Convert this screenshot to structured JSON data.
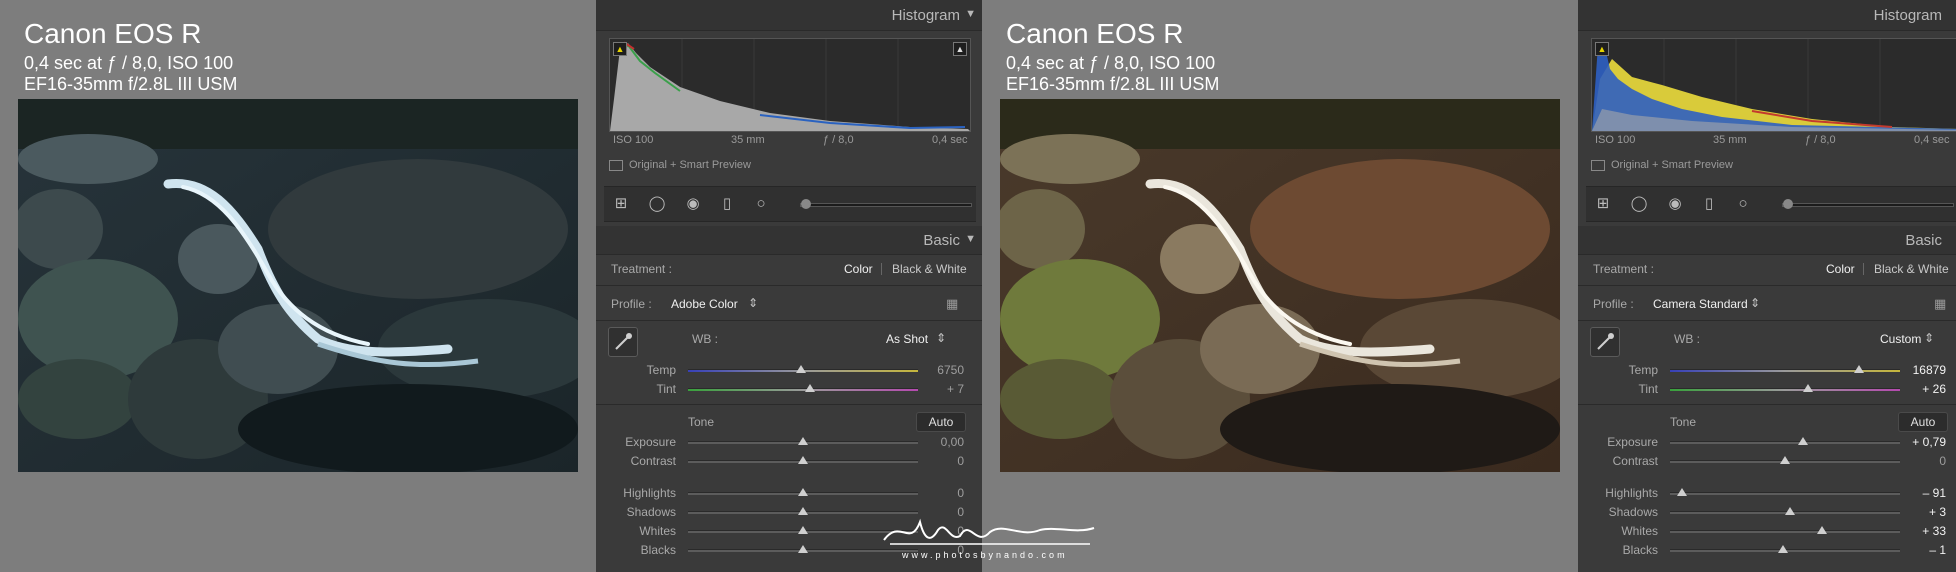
{
  "photo_info": {
    "camera": "Canon EOS R",
    "exposure": "0,4 sec at ƒ / 8,0, ISO 100",
    "lens": "EF16-35mm f/2.8L III USM"
  },
  "sections": {
    "histogram_title": "Histogram",
    "basic_title": "Basic"
  },
  "exif": {
    "iso": "ISO 100",
    "focal": "35 mm",
    "aperture": "ƒ / 8,0",
    "shutter": "0,4 sec"
  },
  "preview_status": "Original + Smart Preview",
  "labels": {
    "treatment": "Treatment :",
    "color": "Color",
    "bw": "Black & White",
    "profile": "Profile :",
    "wb": "WB :",
    "temp": "Temp",
    "tint": "Tint",
    "tone": "Tone",
    "auto": "Auto",
    "exposure": "Exposure",
    "contrast": "Contrast",
    "highlights": "Highlights",
    "shadows": "Shadows",
    "whites": "Whites",
    "blacks": "Blacks"
  },
  "icons": {
    "histogram_collapse": "triangle-down-icon",
    "clipping_warning": "triangle-warning-icon",
    "crop": "crop-icon",
    "spot": "spot-removal-icon",
    "redeye": "red-eye-icon",
    "graduated": "graduated-filter-icon",
    "radial": "radial-filter-icon",
    "dropper": "eyedropper-icon",
    "profile_grid": "grid-icon"
  },
  "left": {
    "profile": "Adobe Color",
    "wb_mode": "As Shot",
    "temp": "6750",
    "tint": "+ 7",
    "exposure": "0,00",
    "contrast": "0",
    "highlights": "0",
    "shadows": "0",
    "whites": "0",
    "blacks": "0",
    "slider_levels": {
      "temp": 0.49,
      "tint": 0.53,
      "exposure": 0.5,
      "contrast": 0.5,
      "highlights": 0.5,
      "shadows": 0.5,
      "whites": 0.5,
      "blacks": 0.5
    }
  },
  "right": {
    "profile": "Camera Standard",
    "wb_mode": "Custom",
    "temp": "16879",
    "tint": "+ 26",
    "exposure": "+ 0,79",
    "contrast": "0",
    "highlights": "– 91",
    "shadows": "+ 3",
    "whites": "+ 33",
    "blacks": "– 1",
    "slider_levels": {
      "temp": 0.82,
      "tint": 0.6,
      "exposure": 0.58,
      "contrast": 0.5,
      "highlights": 0.05,
      "shadows": 0.52,
      "whites": 0.66,
      "blacks": 0.49
    }
  },
  "watermark": {
    "site": "www.photosbynando.com"
  }
}
